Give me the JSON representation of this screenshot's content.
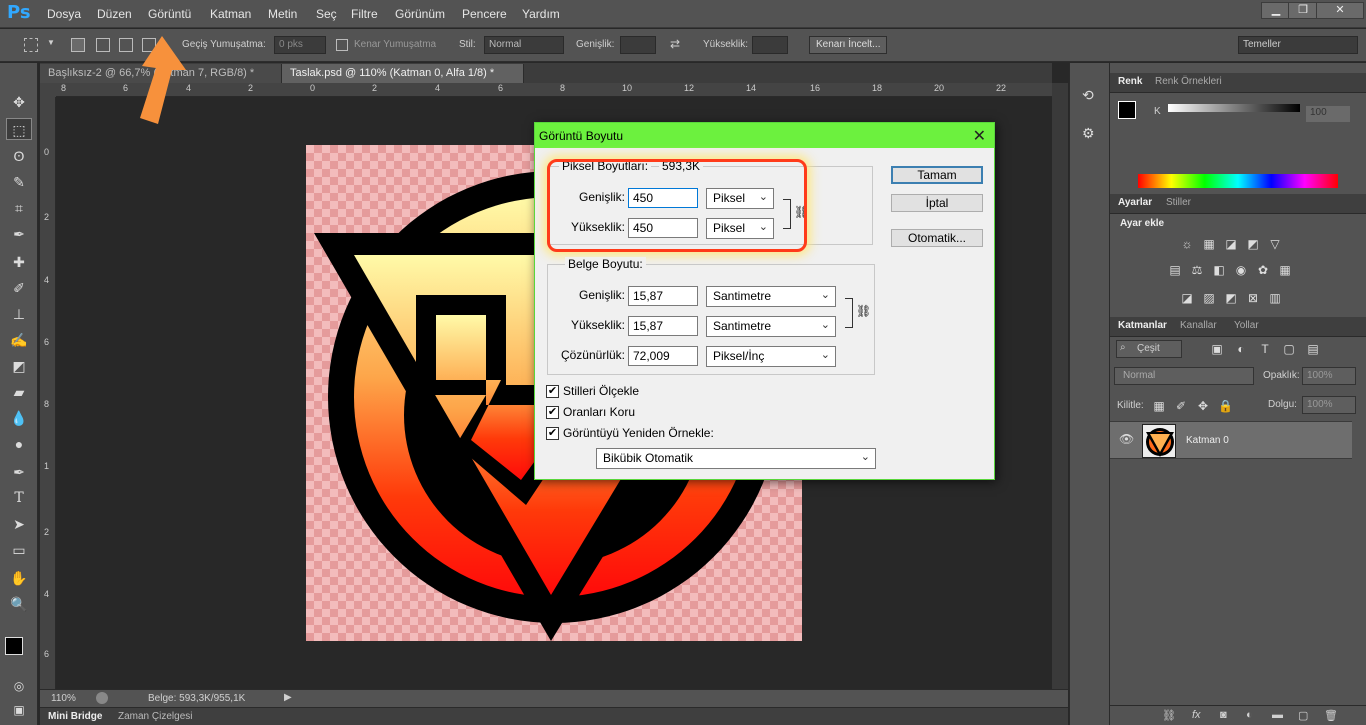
{
  "app": {
    "logo": "Ps"
  },
  "menu": [
    "Dosya",
    "Düzen",
    "Görüntü",
    "Katman",
    "Metin",
    "Seç",
    "Filtre",
    "Görünüm",
    "Pencere",
    "Yardım"
  ],
  "window_controls": [
    "minimize-icon",
    "restore-icon",
    "close-icon"
  ],
  "options_bar": {
    "feather_label": "Geçiş Yumuşatma:",
    "feather_value": "0 pks",
    "antialias_label": "Kenar Yumuşatma",
    "style_label": "Stil:",
    "style_value": "Normal",
    "width_label": "Genişlik:",
    "height_label": "Yükseklik:",
    "refine_button": "Kenarı İncelt...",
    "workspace": "Temeller"
  },
  "tabs": [
    {
      "label": "Başlıksız-2 @ 66,7% (Katman 7, RGB/8) *",
      "active": false
    },
    {
      "label": "Taslak.psd @ 110% (Katman 0, Alfa 1/8) *",
      "active": true
    }
  ],
  "ruler_h": [
    "8",
    "6",
    "4",
    "2",
    "0",
    "2",
    "4",
    "6",
    "8",
    "10",
    "12",
    "14",
    "16",
    "18",
    "20",
    "22"
  ],
  "ruler_v": [
    "0",
    "2",
    "4",
    "6",
    "8",
    "1",
    "2",
    "4",
    "6"
  ],
  "status": {
    "zoom": "110%",
    "doc_size": "Belge: 593,3K/955,1K"
  },
  "bottom_tabs": [
    "Mini Bridge",
    "Zaman Çizelgesi"
  ],
  "color_panel": {
    "tabs": [
      "Renk",
      "Renk Örnekleri"
    ],
    "channel": "K",
    "value": "100"
  },
  "adjustments_panel": {
    "tabs": [
      "Ayarlar",
      "Stiller"
    ],
    "title": "Ayar ekle"
  },
  "layers_panel": {
    "tabs": [
      "Katmanlar",
      "Kanallar",
      "Yollar"
    ],
    "filter": "Çeşit",
    "blend_mode": "Normal",
    "opacity_label": "Opaklık:",
    "opacity_value": "100%",
    "lock_label": "Kilitle:",
    "fill_label": "Dolgu:",
    "fill_value": "100%",
    "layers": [
      {
        "name": "Katman 0",
        "visible": true
      }
    ]
  },
  "dialog": {
    "title": "Görüntü Boyutu",
    "pixel_dims_label": "Piksel Boyutları:",
    "pixel_dims_value": "593,3K",
    "px_width_label": "Genişlik:",
    "px_width_value": "450",
    "px_width_unit": "Piksel",
    "px_height_label": "Yükseklik:",
    "px_height_value": "450",
    "px_height_unit": "Piksel",
    "doc_size_label": "Belge Boyutu:",
    "doc_width_label": "Genişlik:",
    "doc_width_value": "15,87",
    "doc_width_unit": "Santimetre",
    "doc_height_label": "Yükseklik:",
    "doc_height_value": "15,87",
    "doc_height_unit": "Santimetre",
    "resolution_label": "Çözünürlük:",
    "resolution_value": "72,009",
    "resolution_unit": "Piksel/İnç",
    "scale_styles": "Stilleri Ölçekle",
    "constrain": "Oranları Koru",
    "resample": "Görüntüyü Yeniden Örnekle:",
    "resample_method": "Bikübik Otomatik",
    "ok": "Tamam",
    "cancel": "İptal",
    "auto": "Otomatik..."
  },
  "colors": {
    "accent_green": "#6cf13e",
    "highlight_red": "#ff3b1a",
    "arrow_orange": "#f7913c"
  }
}
